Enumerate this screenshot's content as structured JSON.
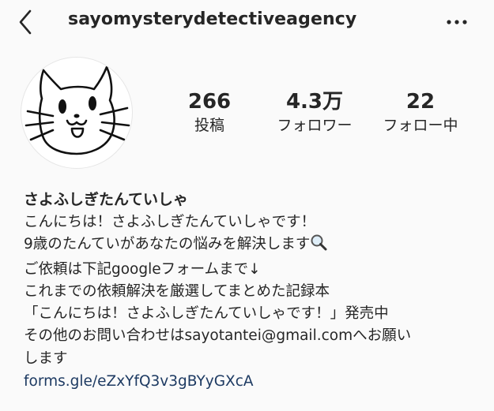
{
  "header": {
    "username": "sayomysterydetectiveagency",
    "back_icon": "chevron-left-icon",
    "more_icon": "more-horizontal-icon"
  },
  "profile": {
    "avatar_icon": "cat-face-drawing",
    "stats": [
      {
        "value": "266",
        "label": "投稿"
      },
      {
        "value": "4.3万",
        "label": "フォロワー"
      },
      {
        "value": "22",
        "label": "フォロー中"
      }
    ]
  },
  "bio": {
    "display_name": "さよふしぎたんていしゃ",
    "lines": [
      "こんにちは！さよふしぎたんていしゃです！",
      "9歳のたんていがあなたの悩みを解決します",
      "ご依頼は下記googleフォームまで↓",
      "これまでの依頼解決を厳選してまとめた記録本",
      "「こんにちは！さよふしぎたんていしゃです！」発売中",
      "その他のお問い合わせはsayotantei@gmail.comへお願い",
      "します"
    ],
    "line2_emoji": "magnifying-glass-icon",
    "link": "forms.gle/eZxYfQ3v3gBYyGXcA",
    "link_color": "#1d3a62"
  }
}
